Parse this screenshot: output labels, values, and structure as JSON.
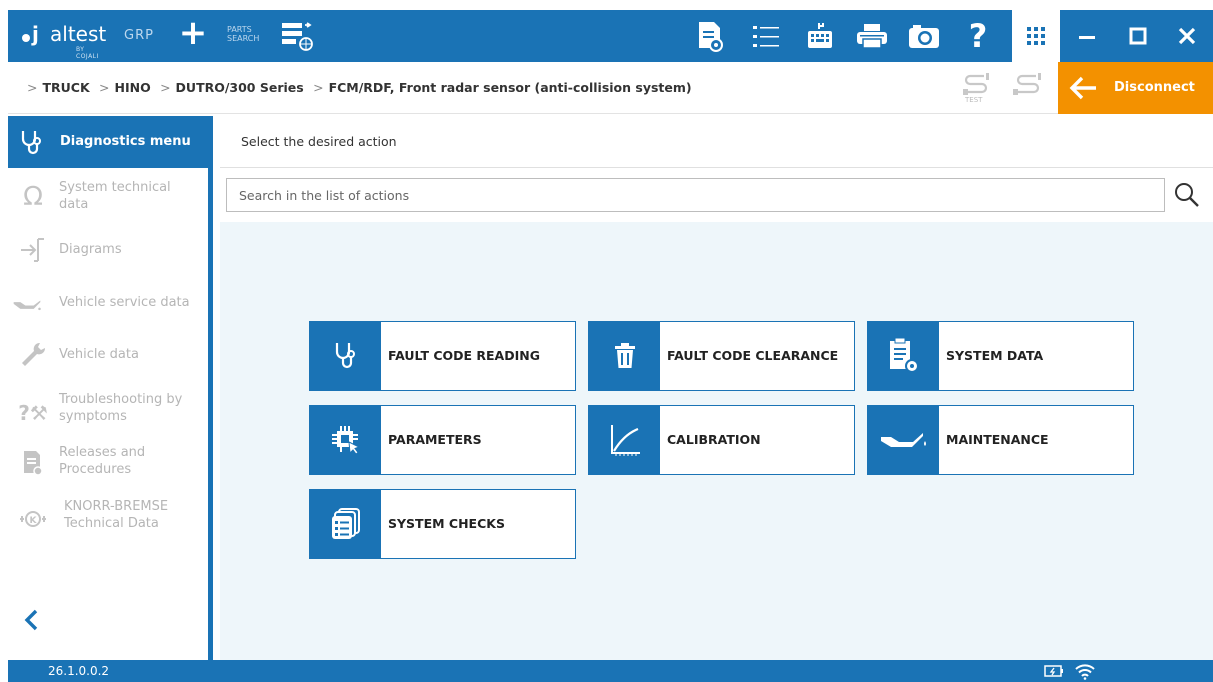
{
  "app": {
    "logo_text": "jaltest",
    "logo_sub": "BY COJALI",
    "mode": "GRP",
    "parts_search": [
      "PARTS",
      "SEARCH"
    ]
  },
  "toolbar_icons": [
    "report-icon",
    "list-icon",
    "keyboard-icon",
    "printer-icon",
    "camera-icon",
    "help-icon",
    "apps-grid-icon"
  ],
  "window_buttons": [
    "minimize-icon",
    "maximize-icon",
    "close-icon"
  ],
  "breadcrumb": [
    "TRUCK",
    "HINO",
    "DUTRO/300 Series",
    "FCM/RDF, Front radar sensor (anti-collision system)"
  ],
  "test_label": "TEST",
  "disconnect_label": "Disconnect",
  "sidebar": {
    "active": "Diagnostics menu",
    "items": [
      {
        "label": "System technical\ndata",
        "icon": "omega-icon"
      },
      {
        "label": "Diagrams",
        "icon": "diagram-icon"
      },
      {
        "label": "Vehicle service data",
        "icon": "oil-can-icon"
      },
      {
        "label": "Vehicle data",
        "icon": "wrench-icon"
      },
      {
        "label": "Troubleshooting by\nsymptoms",
        "icon": "troubleshoot-icon"
      },
      {
        "label": "Releases and\nProcedures",
        "icon": "procedures-icon"
      },
      {
        "label": "KNORR-BREMSE\nTechnical Data",
        "icon": "knorr-icon"
      }
    ]
  },
  "main": {
    "heading": "Select the desired action",
    "search_placeholder": "Search in the list of actions",
    "actions": [
      {
        "label": "FAULT CODE READING",
        "icon": "stethoscope-icon"
      },
      {
        "label": "FAULT CODE CLEARANCE",
        "icon": "trash-icon"
      },
      {
        "label": "SYSTEM DATA",
        "icon": "clipboard-gear-icon"
      },
      {
        "label": "PARAMETERS",
        "icon": "chip-cursor-icon"
      },
      {
        "label": "CALIBRATION",
        "icon": "curve-graph-icon"
      },
      {
        "label": "MAINTENANCE",
        "icon": "oil-can-icon"
      },
      {
        "label": "SYSTEM CHECKS",
        "icon": "checklist-icon"
      }
    ]
  },
  "status": {
    "version": "26.1.0.0.2"
  },
  "colors": {
    "primary": "#1a73b5",
    "accent": "#f39100",
    "content_bg": "#eef6fa"
  }
}
